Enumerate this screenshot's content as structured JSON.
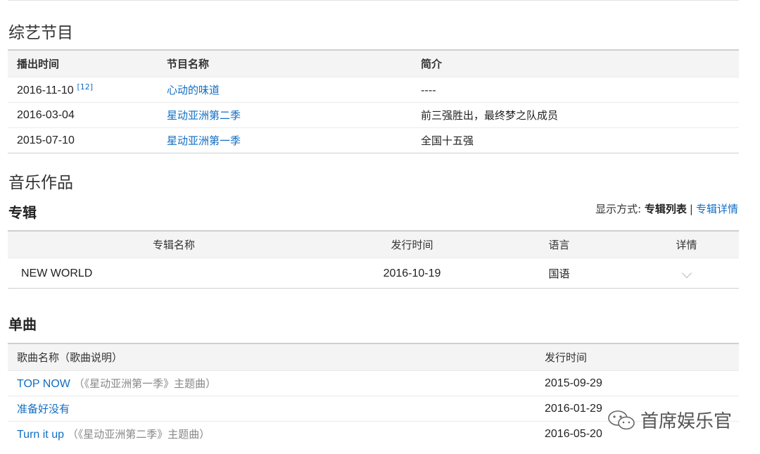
{
  "variety": {
    "heading": "综艺节目",
    "headers": [
      "播出时间",
      "节目名称",
      "简介"
    ],
    "rows": [
      {
        "date": "2016-11-10",
        "ref": "[12]",
        "name": "心动的味道",
        "intro": "----"
      },
      {
        "date": "2016-03-04",
        "name": "星动亚洲第二季",
        "intro": "前三强胜出，最终梦之队成员"
      },
      {
        "date": "2015-07-10",
        "name": "星动亚洲第一季",
        "intro": "全国十五强"
      }
    ]
  },
  "music": {
    "heading": "音乐作品",
    "albums": {
      "heading": "专辑",
      "display_label": "显示方式:",
      "mode_list": "专辑列表",
      "separator": "|",
      "mode_detail": "专辑详情",
      "headers": [
        "专辑名称",
        "发行时间",
        "语言",
        "详情"
      ],
      "rows": [
        {
          "name": "NEW WORLD",
          "date": "2016-10-19",
          "language": "国语",
          "detail_icon": "chevron-down-icon"
        }
      ]
    },
    "singles": {
      "heading": "单曲",
      "headers": [
        "歌曲名称（歌曲说明）",
        "发行时间"
      ],
      "rows": [
        {
          "title": "TOP NOW",
          "note": "（《星动亚洲第一季》主题曲）",
          "date": "2015-09-29"
        },
        {
          "title": "准备好没有",
          "note": "",
          "date": "2016-01-29"
        },
        {
          "title": "Turn it up",
          "note": "（《星动亚洲第二季》主题曲）",
          "date": "2016-05-20"
        }
      ]
    }
  },
  "watermark": {
    "text": "首席娱乐官",
    "icon": "wechat-icon"
  },
  "colors": {
    "link": "#136ec2",
    "header_bg": "#f4f4f4"
  }
}
